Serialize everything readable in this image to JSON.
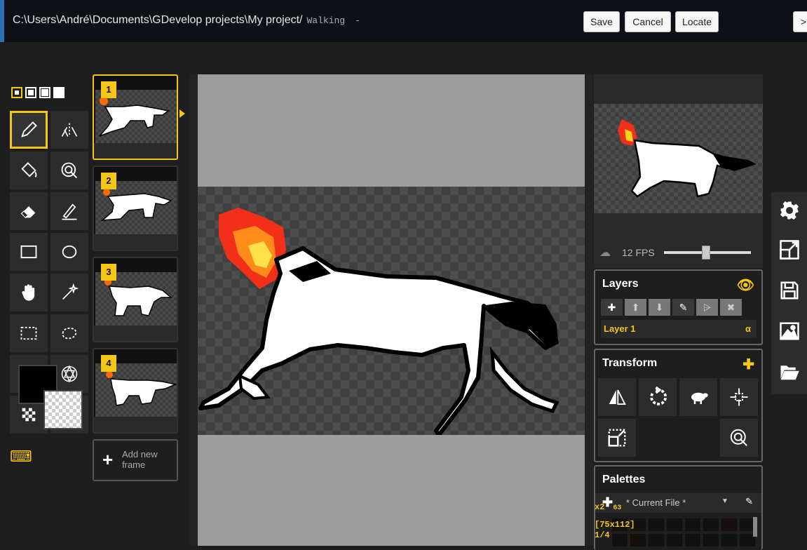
{
  "topbar": {
    "path": "C:\\Users\\André\\Documents\\GDevelop projects\\My project/",
    "animation_name": "Walking",
    "suffix": "-",
    "save_label": "Save",
    "cancel_label": "Cancel",
    "locate_label": "Locate",
    "more_label": ">"
  },
  "tools": {
    "pen_sizes": [
      "pen-size-1",
      "pen-size-2",
      "pen-size-3",
      "pen-size-4"
    ],
    "items": [
      "pen-icon",
      "vertical-mirror-pen-icon",
      "paint-bucket-icon",
      "paint-all-similar-icon",
      "eraser-icon",
      "stroke-icon",
      "rectangle-icon",
      "circle-icon",
      "hand-icon",
      "magic-wand-icon",
      "rectangle-select-icon",
      "lasso-select-icon",
      "move-icon",
      "shape-select-icon",
      "dithering-icon",
      "color-picker-icon"
    ],
    "selected": "pen-icon",
    "primary_color": "#000000",
    "secondary_color": "transparent"
  },
  "frames": {
    "items": [
      {
        "number": "1",
        "selected": true
      },
      {
        "number": "2",
        "selected": false
      },
      {
        "number": "3",
        "selected": false
      },
      {
        "number": "4",
        "selected": false
      }
    ],
    "add_label_1": "Add new",
    "add_label_2": "frame"
  },
  "preview": {
    "fps_label": "12 FPS",
    "fps_value": 12
  },
  "layers": {
    "title": "Layers",
    "layer_name": "Layer 1",
    "alpha_label": "α"
  },
  "transform": {
    "title": "Transform"
  },
  "palettes": {
    "title": "Palettes",
    "current": "* Current File *"
  },
  "cursor": {
    "coords": "x2",
    "y": "63",
    "size": "[75x112]",
    "frame": "1/4"
  },
  "colors": {
    "accent": "#f5c518",
    "background": "#1e1e1e"
  }
}
